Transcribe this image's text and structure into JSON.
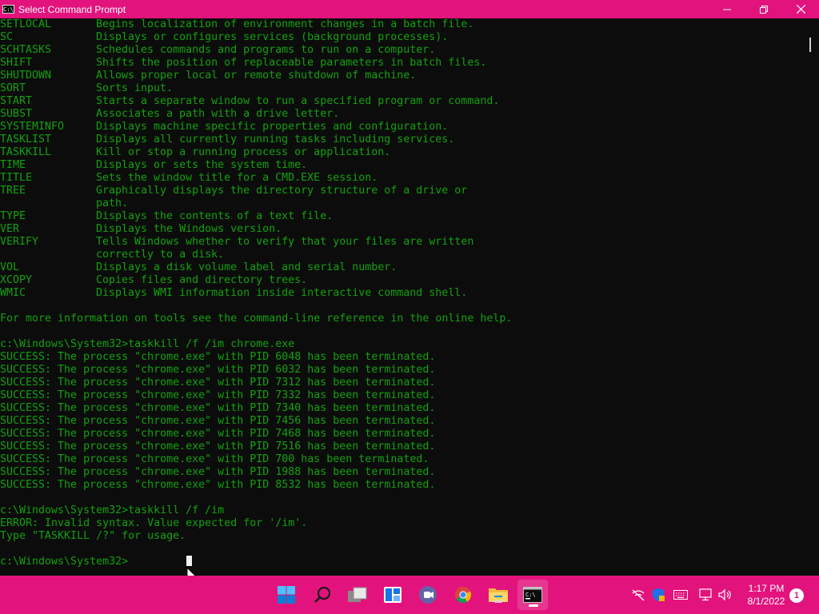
{
  "window": {
    "title": "Select Command Prompt",
    "icon_label": "C:\\",
    "minimize_icon": "minimize-icon",
    "maximize_icon": "restore-icon",
    "close_icon": "close-icon"
  },
  "terminal": {
    "help_rows": [
      {
        "cmd": "SETLOCAL",
        "desc": "Begins localization of environment changes in a batch file."
      },
      {
        "cmd": "SC",
        "desc": "Displays or configures services (background processes)."
      },
      {
        "cmd": "SCHTASKS",
        "desc": "Schedules commands and programs to run on a computer."
      },
      {
        "cmd": "SHIFT",
        "desc": "Shifts the position of replaceable parameters in batch files."
      },
      {
        "cmd": "SHUTDOWN",
        "desc": "Allows proper local or remote shutdown of machine."
      },
      {
        "cmd": "SORT",
        "desc": "Sorts input."
      },
      {
        "cmd": "START",
        "desc": "Starts a separate window to run a specified program or command."
      },
      {
        "cmd": "SUBST",
        "desc": "Associates a path with a drive letter."
      },
      {
        "cmd": "SYSTEMINFO",
        "desc": "Displays machine specific properties and configuration."
      },
      {
        "cmd": "TASKLIST",
        "desc": "Displays all currently running tasks including services."
      },
      {
        "cmd": "TASKKILL",
        "desc": "Kill or stop a running process or application."
      },
      {
        "cmd": "TIME",
        "desc": "Displays or sets the system time."
      },
      {
        "cmd": "TITLE",
        "desc": "Sets the window title for a CMD.EXE session."
      },
      {
        "cmd": "TREE",
        "desc": "Graphically displays the directory structure of a drive or"
      },
      {
        "cmd": "",
        "desc": "path."
      },
      {
        "cmd": "TYPE",
        "desc": "Displays the contents of a text file."
      },
      {
        "cmd": "VER",
        "desc": "Displays the Windows version."
      },
      {
        "cmd": "VERIFY",
        "desc": "Tells Windows whether to verify that your files are written"
      },
      {
        "cmd": "",
        "desc": "correctly to a disk."
      },
      {
        "cmd": "VOL",
        "desc": "Displays a disk volume label and serial number."
      },
      {
        "cmd": "XCOPY",
        "desc": "Copies files and directory trees."
      },
      {
        "cmd": "WMIC",
        "desc": "Displays WMI information inside interactive command shell."
      }
    ],
    "more_info": "For more information on tools see the command-line reference in the online help.",
    "prompt1": "c:\\Windows\\System32>taskkill /f /im chrome.exe",
    "success_lines": [
      "SUCCESS: The process \"chrome.exe\" with PID 6048 has been terminated.",
      "SUCCESS: The process \"chrome.exe\" with PID 6032 has been terminated.",
      "SUCCESS: The process \"chrome.exe\" with PID 7312 has been terminated.",
      "SUCCESS: The process \"chrome.exe\" with PID 7332 has been terminated.",
      "SUCCESS: The process \"chrome.exe\" with PID 7340 has been terminated.",
      "SUCCESS: The process \"chrome.exe\" with PID 7456 has been terminated.",
      "SUCCESS: The process \"chrome.exe\" with PID 7468 has been terminated.",
      "SUCCESS: The process \"chrome.exe\" with PID 7516 has been terminated.",
      "SUCCESS: The process \"chrome.exe\" with PID 700 has been terminated.",
      "SUCCESS: The process \"chrome.exe\" with PID 1988 has been terminated.",
      "SUCCESS: The process \"chrome.exe\" with PID 8532 has been terminated."
    ],
    "prompt2": "c:\\Windows\\System32>taskkill /f /im",
    "error_line": "ERROR: Invalid syntax. Value expected for '/im'.",
    "usage_line": "Type \"TASKKILL /?\" for usage.",
    "prompt3": "c:\\Windows\\System32>"
  },
  "taskbar": {
    "icons": [
      "windows-start-icon",
      "search-icon",
      "task-view-icon",
      "widgets-icon",
      "teams-chat-icon",
      "chrome-icon",
      "file-explorer-icon",
      "command-prompt-icon"
    ],
    "tray_icons": [
      "network-off-icon",
      "security-icon",
      "keyboard-icon",
      "display-icon",
      "volume-icon"
    ],
    "time": "1:17 PM",
    "date": "8/1/2022",
    "notification_count": "1"
  },
  "colors": {
    "accent": "#e3137d",
    "terminal_bg": "#0c0c0c",
    "terminal_text": "#13a10e"
  }
}
